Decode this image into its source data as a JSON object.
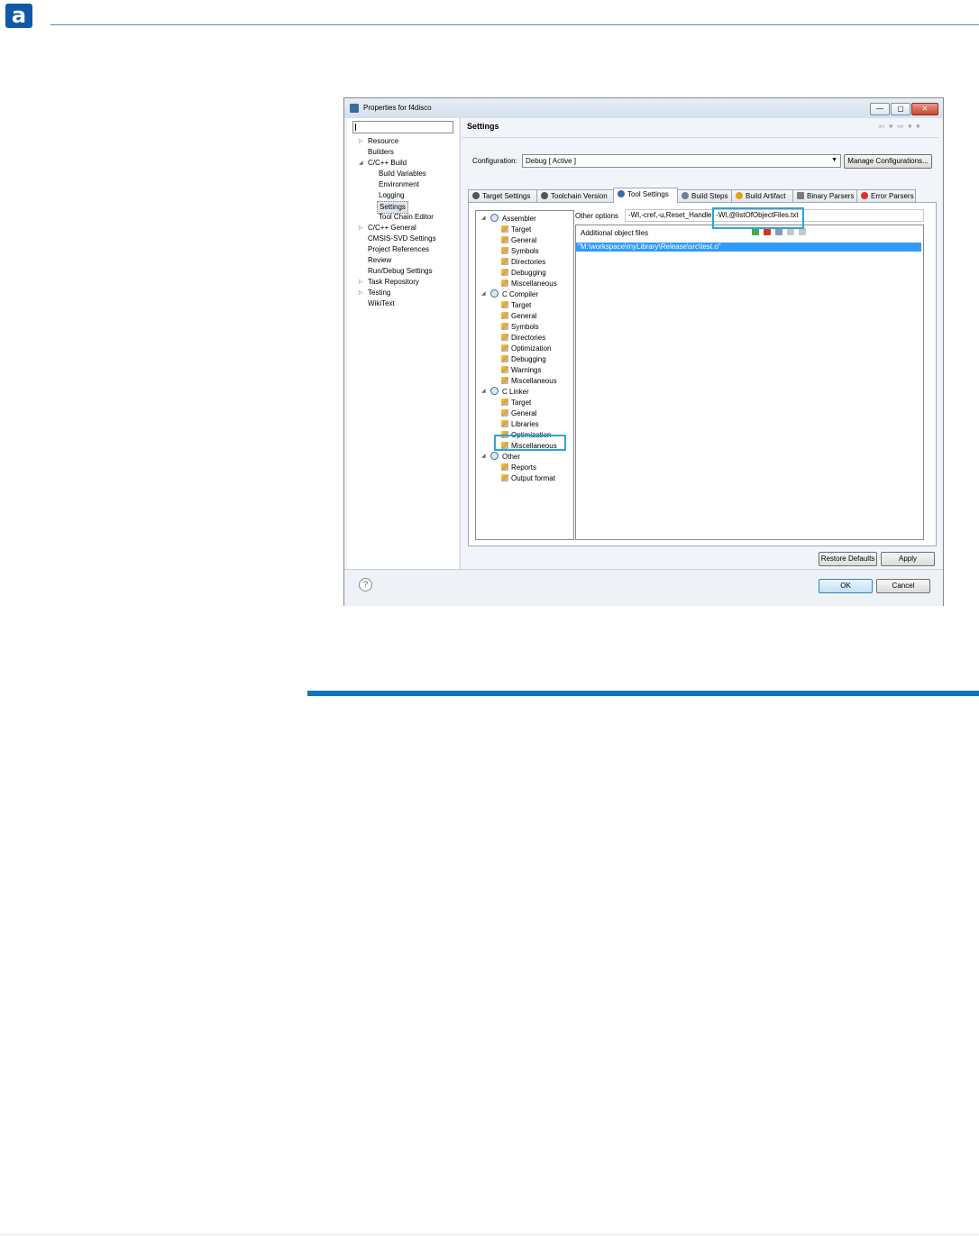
{
  "page": {
    "logo_letter": "a"
  },
  "window": {
    "title": "Properties for f4disco",
    "min_glyph": "—",
    "max_glyph": "▢",
    "close_glyph": "✕"
  },
  "nav": {
    "filter_value": "",
    "items": [
      {
        "label": "Resource",
        "expander": "▷"
      },
      {
        "label": "Builders",
        "expander": ""
      },
      {
        "label": "C/C++ Build",
        "expander": "◢"
      },
      {
        "label": "Build Variables",
        "expander": ""
      },
      {
        "label": "Environment",
        "expander": ""
      },
      {
        "label": "Logging",
        "expander": ""
      },
      {
        "label": "Settings",
        "expander": ""
      },
      {
        "label": "Tool Chain Editor",
        "expander": ""
      },
      {
        "label": "C/C++ General",
        "expander": "▷"
      },
      {
        "label": "CMSIS-SVD Settings",
        "expander": ""
      },
      {
        "label": "Project References",
        "expander": ""
      },
      {
        "label": "Review",
        "expander": ""
      },
      {
        "label": "Run/Debug Settings",
        "expander": ""
      },
      {
        "label": "Task Repository",
        "expander": "▷"
      },
      {
        "label": "Testing",
        "expander": "▷"
      },
      {
        "label": "WikiText",
        "expander": ""
      }
    ]
  },
  "settings": {
    "title": "Settings",
    "nav_arrows": "⇦ ▾ ⇨ ▾ ▾",
    "configuration_label": "Configuration:",
    "configuration_value": "Debug  [ Active ]",
    "manage_button": "Manage Configurations...",
    "tabs": [
      {
        "label": "Target Settings",
        "icon_color": "#555555"
      },
      {
        "label": "Toolchain Version",
        "icon_color": "#555555"
      },
      {
        "label": "Tool Settings",
        "icon_color": "#3b6aa0"
      },
      {
        "label": "Build Steps",
        "icon_color": "#6a7f96"
      },
      {
        "label": "Build Artifact",
        "icon_color": "#e2a11b"
      },
      {
        "label": "Binary Parsers",
        "icon_color": "#7a7a7a"
      },
      {
        "label": "Error Parsers",
        "icon_color": "#d8322a"
      }
    ],
    "tree": {
      "groups": [
        {
          "label": "Assembler",
          "expander": "◢",
          "children": [
            "Target",
            "General",
            "Symbols",
            "Directories",
            "Debugging",
            "Miscellaneous"
          ]
        },
        {
          "label": "C Compiler",
          "expander": "◢",
          "children": [
            "Target",
            "General",
            "Symbols",
            "Directories",
            "Optimization",
            "Debugging",
            "Warnings",
            "Miscellaneous"
          ]
        },
        {
          "label": "C Linker",
          "expander": "◢",
          "children": [
            "Target",
            "General",
            "Libraries",
            "Optimization",
            "Miscellaneous"
          ]
        },
        {
          "label": "Other",
          "expander": "◢",
          "children": [
            "Reports",
            "Output format"
          ]
        }
      ]
    },
    "other_options_label": "Other options",
    "other_options_value": "-Wl,-cref,-u,Reset_Handler -Wl,@listOfObjectFiles.txt",
    "additional_object_files_label": "Additional object files",
    "object_files": [
      "\"M:\\workspace\\myLibrary\\Release\\src\\test.o\""
    ],
    "restore_defaults_button": "Restore Defaults",
    "apply_button": "Apply"
  },
  "footer": {
    "help_glyph": "?",
    "ok_button": "OK",
    "cancel_button": "Cancel"
  }
}
